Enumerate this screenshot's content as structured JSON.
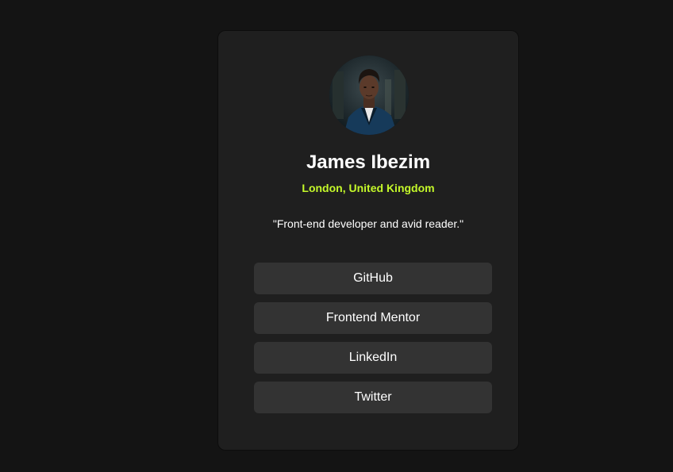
{
  "profile": {
    "name": "James Ibezim",
    "location": "London, United Kingdom",
    "bio": "\"Front-end developer and avid reader.\"",
    "avatar_icon": "profile-photo"
  },
  "links": [
    {
      "label": "GitHub"
    },
    {
      "label": "Frontend Mentor"
    },
    {
      "label": "LinkedIn"
    },
    {
      "label": "Twitter"
    }
  ],
  "colors": {
    "page_background": "#141414",
    "card_background": "#1f1f1f",
    "accent": "#c4f82a",
    "button_background": "#333333",
    "text": "#ffffff"
  }
}
